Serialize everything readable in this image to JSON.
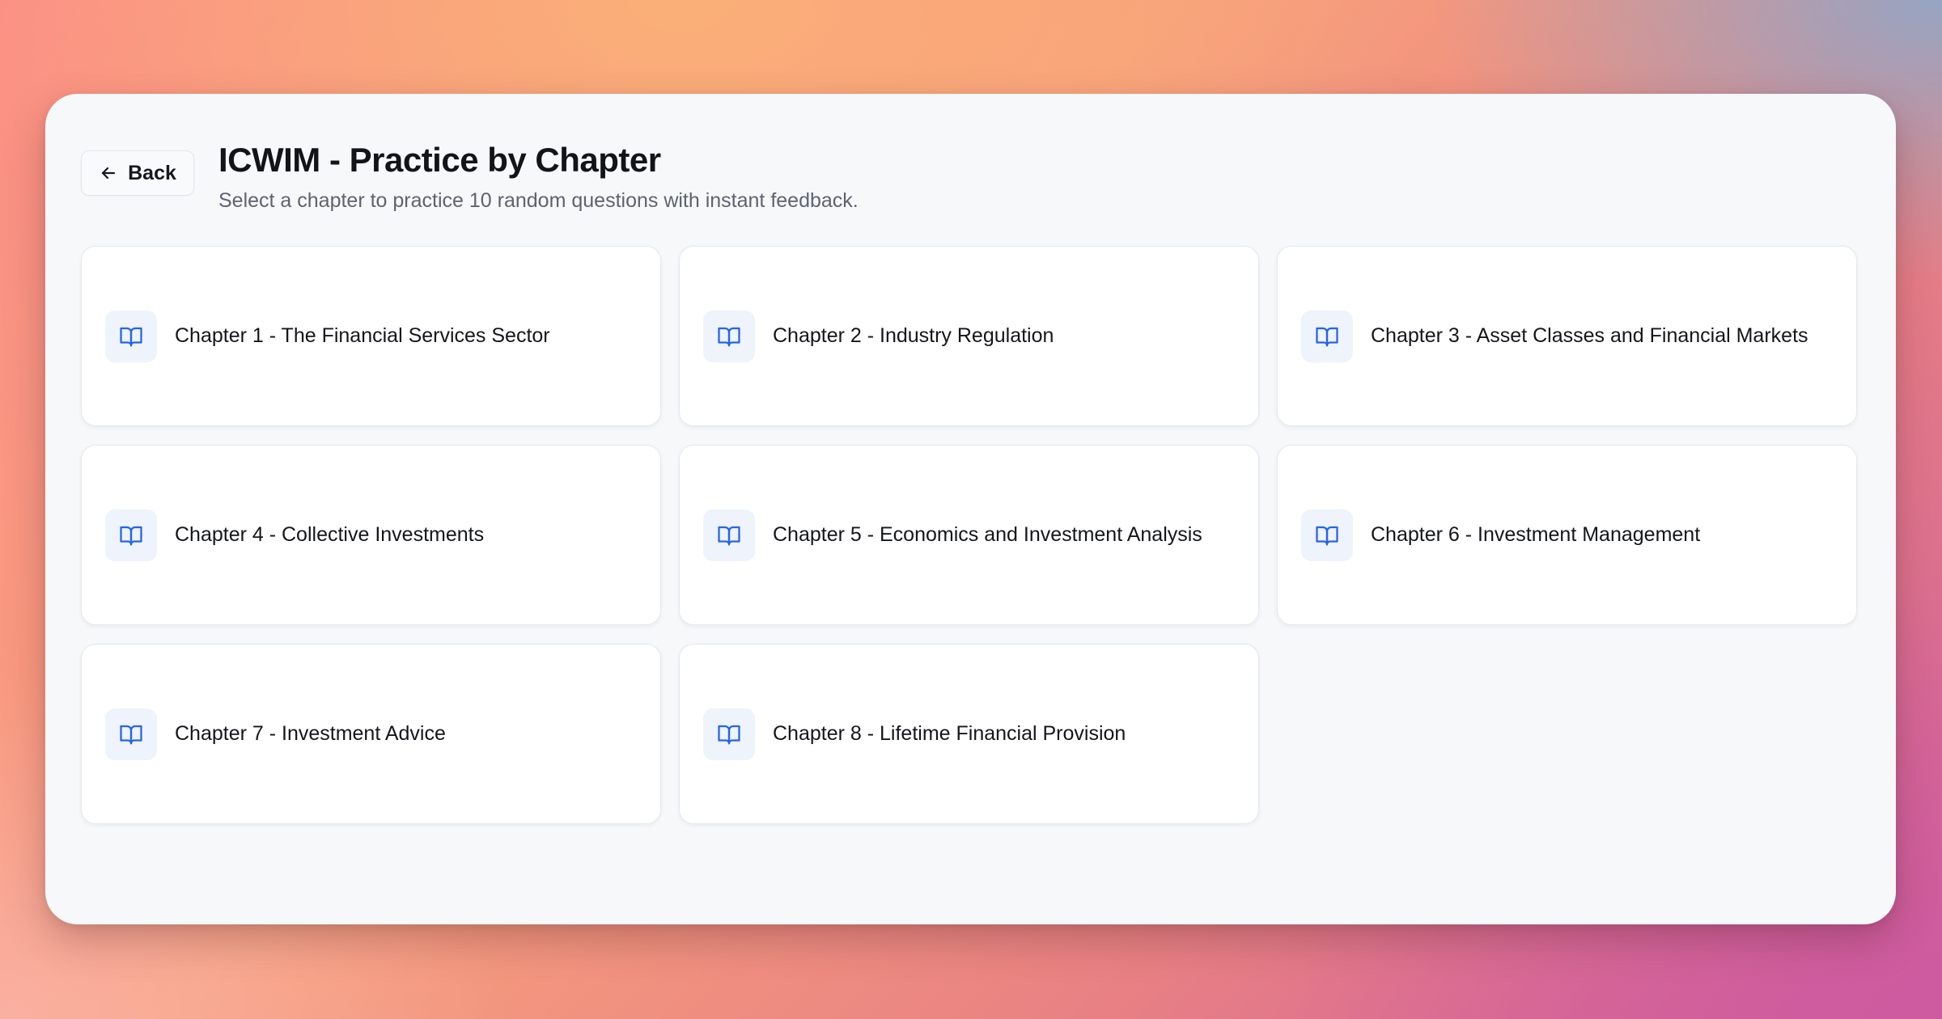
{
  "header": {
    "back_label": "Back",
    "title": "ICWIM - Practice by Chapter",
    "subtitle": "Select a chapter to practice 10 random questions with instant feedback."
  },
  "icons": {
    "back": "arrow-left-icon",
    "chapter": "open-book-icon"
  },
  "colors": {
    "accent": "#2563eb",
    "icon_bg": "#eef3fc"
  },
  "chapters": [
    {
      "label": "Chapter 1 - The Financial Services Sector"
    },
    {
      "label": "Chapter 2 - Industry Regulation"
    },
    {
      "label": "Chapter 3 - Asset Classes and Financial Markets"
    },
    {
      "label": "Chapter 4 - Collective Investments"
    },
    {
      "label": "Chapter 5 - Economics and Investment Analysis"
    },
    {
      "label": "Chapter 6 - Investment Management"
    },
    {
      "label": "Chapter 7 - Investment Advice"
    },
    {
      "label": "Chapter 8 - Lifetime Financial Provision"
    }
  ]
}
